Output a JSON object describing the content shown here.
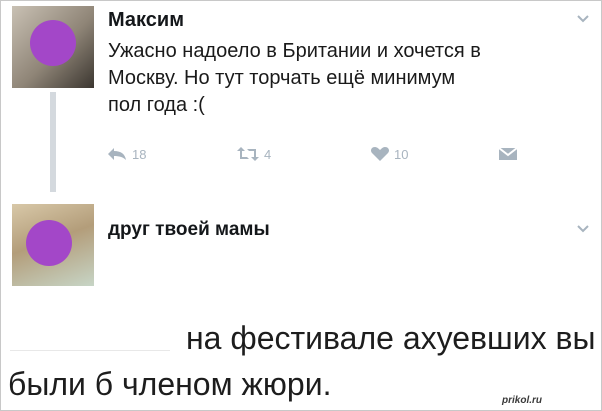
{
  "tweet": {
    "author": "Максим",
    "text_lines": [
      "Ужасно надоело в Британии и хочется в",
      "Москву. Но тут торчать ещё минимум",
      "пол года :("
    ],
    "reply_count": "18",
    "retweet_count": "4",
    "like_count": "10",
    "icons": [
      "reply-icon",
      "retweet-icon",
      "heart-icon",
      "direct-message-icon",
      "chevron-down-icon"
    ]
  },
  "reply": {
    "author": "друг твоей мамы",
    "caption_line1": "на фестивале ахуевших вы",
    "caption_line2": "были б членом жюри."
  },
  "watermark": "prikol.ru",
  "colors": {
    "avatar_blob": "#a347c8",
    "action_icons": "#a8b4bf",
    "thread_line": "#d4d9de"
  }
}
